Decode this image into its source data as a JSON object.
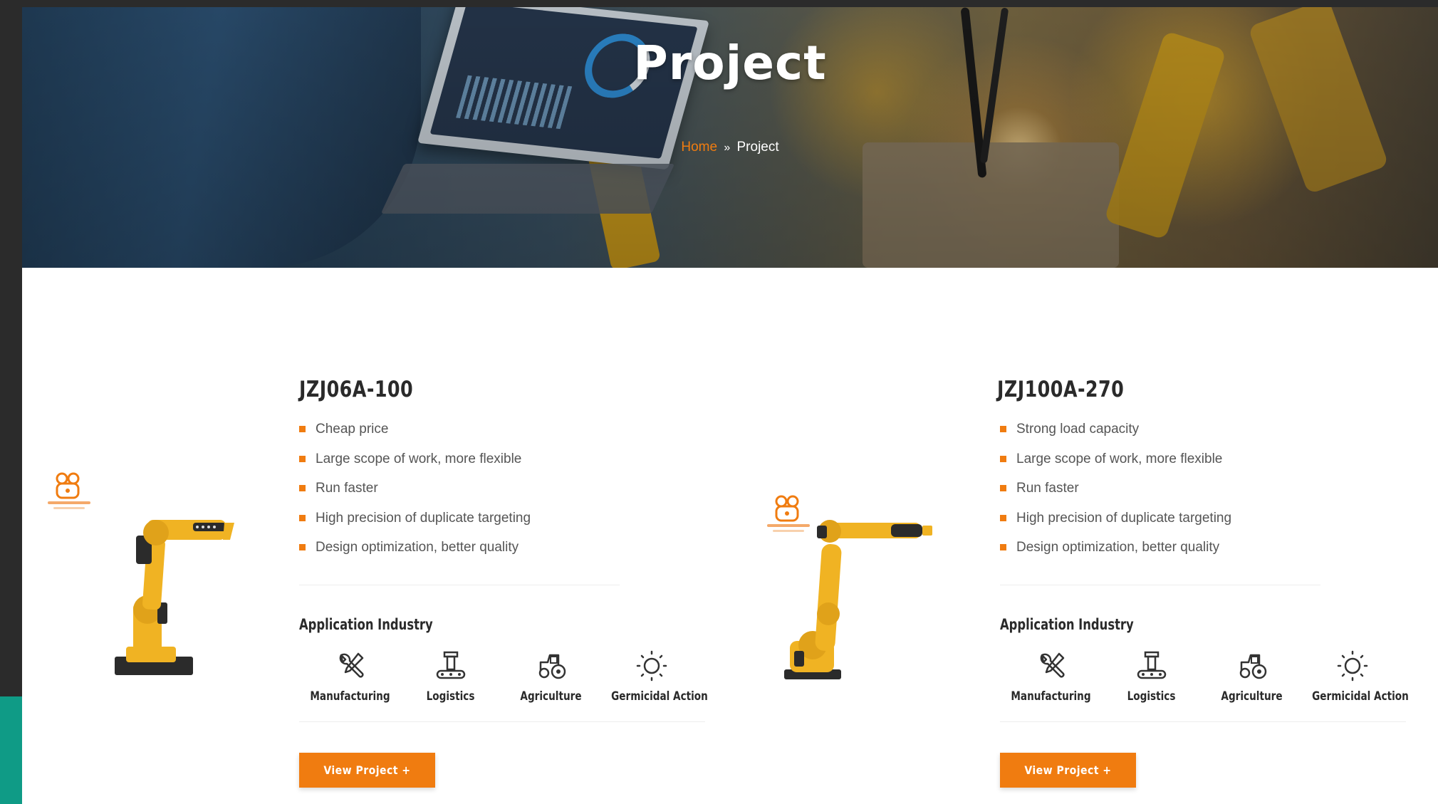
{
  "hero": {
    "title": "Project",
    "breadcrumb": {
      "home": "Home",
      "separator": "»",
      "current": "Project"
    }
  },
  "products": [
    {
      "title": "JZJ06A-100",
      "features": [
        "Cheap price",
        "Large scope of work, more flexible",
        "Run faster",
        "High precision of duplicate targeting",
        "Design optimization, better quality"
      ],
      "application_title": "Application Industry",
      "industries": [
        {
          "label": "Manufacturing",
          "icon": "wrench-screwdriver-icon"
        },
        {
          "label": "Logistics",
          "icon": "conveyor-icon"
        },
        {
          "label": "Agriculture",
          "icon": "tractor-icon"
        },
        {
          "label": "Germicidal Action",
          "icon": "uv-lamp-icon"
        }
      ],
      "button_label": "View Project +"
    },
    {
      "title": "JZJ100A-270",
      "features": [
        "Strong load capacity",
        "Large scope of work, more flexible",
        "Run faster",
        "High precision of duplicate targeting",
        "Design optimization, better quality"
      ],
      "application_title": "Application Industry",
      "industries": [
        {
          "label": "Manufacturing",
          "icon": "wrench-screwdriver-icon"
        },
        {
          "label": "Logistics",
          "icon": "conveyor-icon"
        },
        {
          "label": "Agriculture",
          "icon": "tractor-icon"
        },
        {
          "label": "Germicidal Action",
          "icon": "uv-lamp-icon"
        }
      ],
      "button_label": "View Project +"
    }
  ],
  "colors": {
    "accent": "#f07c10",
    "robot_yellow": "#f0b323",
    "heading": "#2a2a2a",
    "text": "#555555",
    "side_strip": "#0f9b86"
  }
}
